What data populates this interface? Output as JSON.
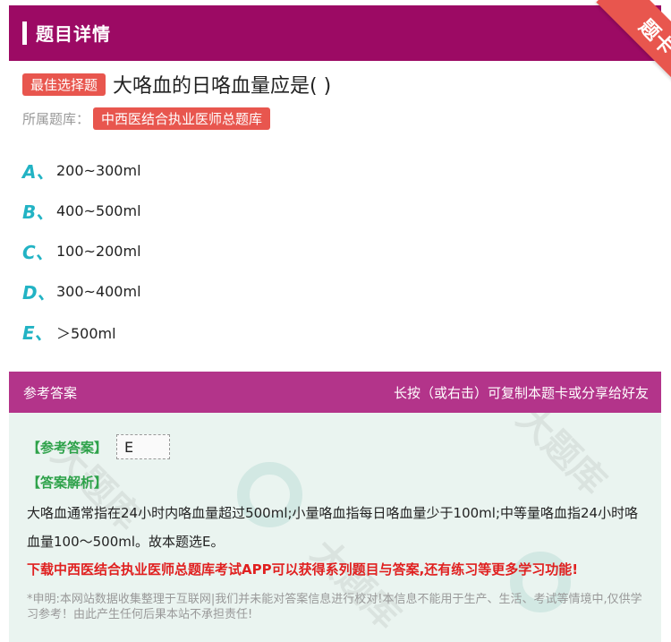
{
  "header": {
    "title": "题目详情",
    "ribbon": "题卡"
  },
  "question": {
    "type_badge": "最佳选择题",
    "text": "大咯血的日咯血量应是( )",
    "bank_label": "所属题库：",
    "bank_name": "中西医结合执业医师总题库"
  },
  "options": [
    {
      "letter": "A、",
      "text": "200~300ml"
    },
    {
      "letter": "B、",
      "text": "400~500ml"
    },
    {
      "letter": "C、",
      "text": "100~200ml"
    },
    {
      "letter": "D、",
      "text": "300~400ml"
    },
    {
      "letter": "E、",
      "text": "＞500ml"
    }
  ],
  "answer_section": {
    "title": "参考答案",
    "share_hint": "长按（或右击）可复制本题卡或分享给好友",
    "answer_label": "【参考答案】",
    "answer_value": "E",
    "explanation_label": "【答案解析】",
    "explanation": "大咯血通常指在24小时内咯血量超过500ml;小量咯血指每日咯血量少于100ml;中等量咯血指24小时咯血量100～500ml。故本题选E。",
    "promo": "下载中西医结合执业医师总题库考试APP可以获得系列题目与答案,还有练习等更多学习功能!",
    "disclaimer": "*申明:本网站数据收集整理于互联网|我们并未能对答案信息进行校对!本信息不能用于生产、生活、考试等情境中,仅供学习参考！由此产生任何后果本站不承担责任!",
    "watermark": "大题库"
  },
  "colors": {
    "header_bg": "#9c0a64",
    "answer_header_bg": "#b3348a",
    "badge": "#e8564e",
    "option_letter": "#22b3c4",
    "label_green": "#2ea24a",
    "promo_red": "#e02020"
  }
}
